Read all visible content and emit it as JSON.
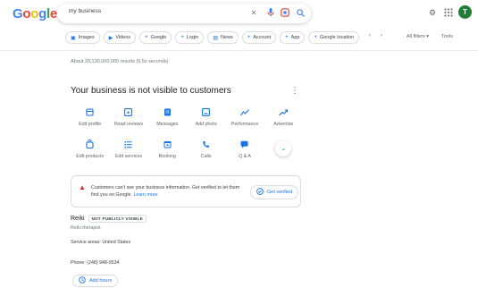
{
  "header": {
    "logo": {
      "l1": "G",
      "l2": "o",
      "l3": "o",
      "l4": "g",
      "l5": "l",
      "l6": "e"
    },
    "search_query": "my business",
    "avatar_initial": "T",
    "icons": [
      "clear-icon",
      "mic-icon",
      "lens-icon",
      "search-icon",
      "gear-icon",
      "apps-icon"
    ]
  },
  "chips": [
    {
      "label": "Images",
      "icon": "image-icon"
    },
    {
      "label": "Videos",
      "icon": "video-icon"
    },
    {
      "label": "Google",
      "icon": "plus-icon"
    },
    {
      "label": "Login",
      "icon": "plus-icon"
    },
    {
      "label": "News",
      "icon": "news-icon"
    },
    {
      "label": "Account",
      "icon": "plus-icon"
    },
    {
      "label": "App",
      "icon": "plus-icon"
    },
    {
      "label": "Google location",
      "icon": "plus-icon"
    }
  ],
  "toolbar": {
    "all_filters": "All filters ▾",
    "tools": "Tools"
  },
  "results_stats": "About 20,130,000,000 results (0.5s seconds)",
  "business": {
    "heading": "Your business is not visible to customers",
    "actions": [
      {
        "label": "Edit profile",
        "icon": "store-icon"
      },
      {
        "label": "Read reviews",
        "icon": "star-box-icon"
      },
      {
        "label": "Messages",
        "icon": "message-icon"
      },
      {
        "label": "Add photo",
        "icon": "photo-icon"
      },
      {
        "label": "Performance",
        "icon": "trend-icon"
      },
      {
        "label": "Advertise",
        "icon": "trend-up-icon"
      },
      {
        "label": "Edit products",
        "icon": "bag-icon"
      },
      {
        "label": "Edit services",
        "icon": "list-icon"
      },
      {
        "label": "Booking",
        "icon": "calendar-icon"
      },
      {
        "label": "Calls",
        "icon": "phone-icon"
      },
      {
        "label": "Q & A",
        "icon": "chat-icon"
      }
    ],
    "alert": {
      "text": "Customers can't see your business information. Get verified to let them find you on Google.",
      "link": "Learn more",
      "button": "Get verified"
    },
    "name": "Reiki",
    "badge": "NOT PUBLICLY VISIBLE",
    "category": "Reiki therapist",
    "service_areas": "Service areas: United States",
    "phone": "Phone: (248) 948-9534",
    "hours_button": "Add hours"
  },
  "colors": {
    "accent": "#1a73e8",
    "alert": "#d93025",
    "avatar": "#1e7e34"
  }
}
